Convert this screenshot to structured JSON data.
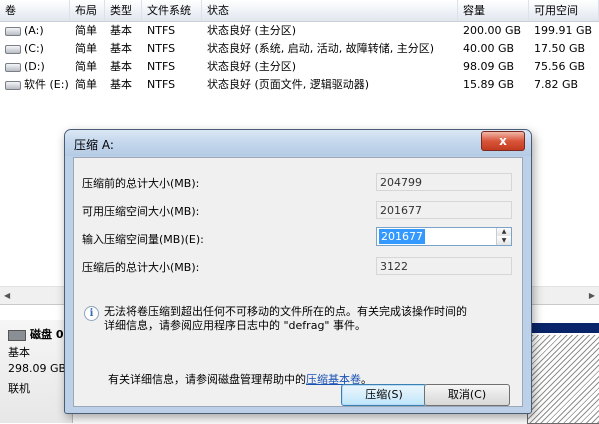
{
  "volume_list": {
    "columns": [
      "卷",
      "布局",
      "类型",
      "文件系统",
      "状态",
      "容量",
      "可用空间"
    ],
    "rows": [
      {
        "volume": "(A:)",
        "layout": "简单",
        "type": "基本",
        "fs": "NTFS",
        "status": "状态良好 (主分区)",
        "capacity": "200.00 GB",
        "free": "199.91 GB"
      },
      {
        "volume": "(C:)",
        "layout": "简单",
        "type": "基本",
        "fs": "NTFS",
        "status": "状态良好 (系统, 启动, 活动, 故障转储, 主分区)",
        "capacity": "40.00 GB",
        "free": "17.50 GB"
      },
      {
        "volume": "(D:)",
        "layout": "简单",
        "type": "基本",
        "fs": "NTFS",
        "status": "状态良好 (主分区)",
        "capacity": "98.09 GB",
        "free": "75.56 GB"
      },
      {
        "volume": "软件 (E:)",
        "layout": "简单",
        "type": "基本",
        "fs": "NTFS",
        "status": "状态良好 (页面文件, 逻辑驱动器)",
        "capacity": "15.89 GB",
        "free": "7.82 GB"
      }
    ]
  },
  "disk_panel": {
    "disk_name": "磁盘 0",
    "disk_type": "基本",
    "disk_size": "298.09 GB",
    "disk_status": "联机"
  },
  "dialog": {
    "title": "压缩 A:",
    "close_glyph": "x",
    "total_before_label": "压缩前的总计大小(MB):",
    "total_before_value": "204799",
    "available_label": "可用压缩空间大小(MB):",
    "available_value": "201677",
    "input_label": "输入压缩空间量(MB)(E):",
    "input_value": "201677",
    "total_after_label": "压缩后的总计大小(MB):",
    "total_after_value": "3122",
    "warning_line1": "无法将卷压缩到超出任何不可移动的文件所在的点。有关完成该操作时间的",
    "warning_line2": "详细信息，请参阅应用程序日志中的 \"defrag\" 事件。",
    "help_prefix": "有关详细信息，请参阅磁盘管理帮助中的",
    "help_link": "压缩基本卷",
    "help_suffix": "。",
    "shrink_button": "压缩(S)",
    "cancel_button": "取消(C)"
  }
}
